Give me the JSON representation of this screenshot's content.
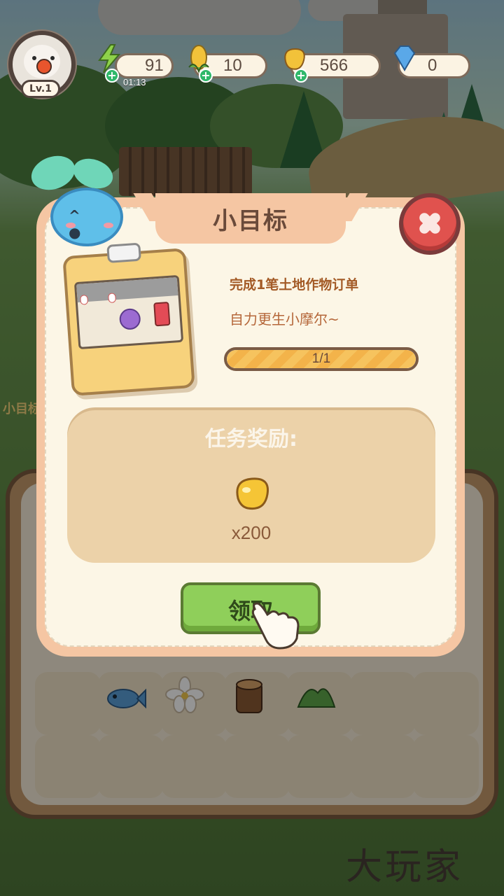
{
  "hud": {
    "level": "Lv.1",
    "energy": {
      "value": "91",
      "timer": "01:13",
      "icon": "lightning-icon"
    },
    "corn": {
      "value": "10",
      "icon": "corn-icon"
    },
    "beans": {
      "value": "566",
      "icon": "bean-icon"
    },
    "gems": {
      "value": "0",
      "icon": "diamond-icon"
    }
  },
  "modal": {
    "title": "小目标",
    "task": {
      "title": "完成1笔土地作物订单",
      "description": "自力更生小摩尔~",
      "progress_text": "1/1",
      "progress": 1.0
    },
    "reward": {
      "label": "任务奖励:",
      "amount": "x200",
      "icon": "bean-icon"
    },
    "claim_label": "领取"
  },
  "background": {
    "side_label": "小目标"
  },
  "watermark": "大玩家",
  "colors": {
    "modal_border": "#f5c6a3",
    "modal_bg": "#fcf6e6",
    "claim_green": "#8fcf5a",
    "close_red": "#e0524e",
    "task_title": "#a35a26"
  }
}
